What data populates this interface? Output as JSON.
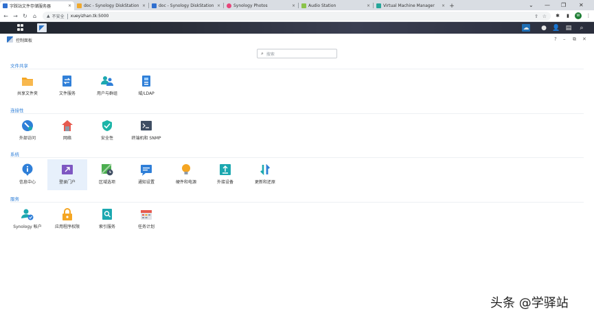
{
  "browser": {
    "tabs": [
      {
        "label": "字踩站文件存储服务器",
        "color": "#2f6fcf",
        "active": true
      },
      {
        "label": "doc - Synology DiskStation",
        "color": "#f0a92e",
        "active": false
      },
      {
        "label": "doc - Synology DiskStation",
        "color": "#2f6fcf",
        "active": false
      },
      {
        "label": "Synology Photos",
        "color": "#e6457a",
        "active": false
      },
      {
        "label": "Audio Station",
        "color": "#8bc34a",
        "active": false
      },
      {
        "label": "Virtual Machine Manager",
        "color": "#26a69a",
        "active": false
      }
    ],
    "close_glyph": "×",
    "new_tab_glyph": "+",
    "address": {
      "warning_glyph": "▲",
      "insecure_label": "不安全",
      "url": "xueyizhan.tk:5000"
    },
    "profile_initial": "W"
  },
  "control_panel": {
    "title": "控制面板",
    "help_glyph": "?",
    "search_placeholder": "搜索"
  },
  "sections": [
    {
      "title": "文件共享",
      "items": [
        {
          "label": "共享文件夹",
          "icon": "shared-folder-icon"
        },
        {
          "label": "文件服务",
          "icon": "file-services-icon"
        },
        {
          "label": "用户与群组",
          "icon": "users-groups-icon"
        },
        {
          "label": "域/LDAP",
          "icon": "domain-ldap-icon"
        }
      ]
    },
    {
      "title": "连接性",
      "items": [
        {
          "label": "外部访问",
          "icon": "external-access-icon"
        },
        {
          "label": "网络",
          "icon": "network-icon"
        },
        {
          "label": "安全性",
          "icon": "security-shield-icon"
        },
        {
          "label": "终端机和 SNMP",
          "icon": "terminal-icon"
        }
      ]
    },
    {
      "title": "系统",
      "items": [
        {
          "label": "信息中心",
          "icon": "info-center-icon"
        },
        {
          "label": "登录门户",
          "icon": "login-portal-icon",
          "selected": true
        },
        {
          "label": "区域选项",
          "icon": "regional-options-icon"
        },
        {
          "label": "通知设置",
          "icon": "notification-icon"
        },
        {
          "label": "硬件和电源",
          "icon": "hardware-power-icon"
        },
        {
          "label": "外接设备",
          "icon": "external-devices-icon"
        },
        {
          "label": "更新和还原",
          "icon": "update-restore-icon"
        }
      ]
    },
    {
      "title": "服务",
      "items": [
        {
          "label": "Synology 帐户",
          "icon": "synology-account-icon"
        },
        {
          "label": "应用程序权限",
          "icon": "app-privileges-icon"
        },
        {
          "label": "索引服务",
          "icon": "indexing-service-icon"
        },
        {
          "label": "任务计划",
          "icon": "task-scheduler-icon"
        }
      ]
    }
  ],
  "watermark": "头条 @学驿站"
}
